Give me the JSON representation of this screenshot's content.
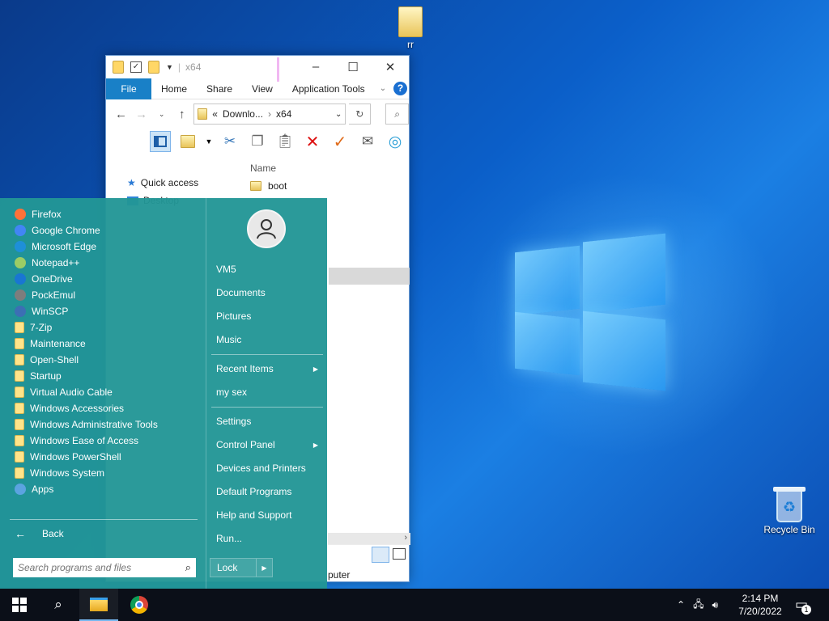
{
  "desktop": {
    "icons": [
      {
        "name": "folder-icon",
        "label": "rr"
      },
      {
        "name": "recycle-bin-icon",
        "label": "Recycle Bin"
      }
    ]
  },
  "explorer": {
    "title": "x64",
    "tabs": [
      {
        "label": "File"
      },
      {
        "label": "Home"
      },
      {
        "label": "Share"
      },
      {
        "label": "View"
      },
      {
        "label": "Application Tools"
      }
    ],
    "help": "?",
    "address": {
      "prefix": "«",
      "crumb1": "Downlo...",
      "crumb2": "x64"
    },
    "nav_items": [
      "Quick access",
      "Desktop"
    ],
    "column_header": "Name",
    "files": [
      "boot"
    ],
    "status_text": "puter"
  },
  "start_menu": {
    "programs": [
      {
        "label": "Firefox",
        "icon": "firefox-icon",
        "color": "#ff7139"
      },
      {
        "label": "Google Chrome",
        "icon": "chrome-icon",
        "color": "#4285f4"
      },
      {
        "label": "Microsoft Edge",
        "icon": "edge-icon",
        "color": "#1e8fd8"
      },
      {
        "label": "Notepad++",
        "icon": "notepadpp-icon",
        "color": "#9ccc65"
      },
      {
        "label": "OneDrive",
        "icon": "onedrive-icon",
        "color": "#1976d2"
      },
      {
        "label": "PockEmul",
        "icon": "pockemul-icon",
        "color": "#7d7d7d"
      },
      {
        "label": "WinSCP",
        "icon": "winscp-icon",
        "color": "#3c6fb4"
      },
      {
        "label": "7-Zip",
        "icon": "folder-icon",
        "color": "#ffe48a"
      },
      {
        "label": "Maintenance",
        "icon": "folder-icon",
        "color": "#ffe48a"
      },
      {
        "label": "Open-Shell",
        "icon": "folder-icon",
        "color": "#ffe48a"
      },
      {
        "label": "Startup",
        "icon": "folder-icon",
        "color": "#ffe48a"
      },
      {
        "label": "Virtual Audio Cable",
        "icon": "folder-icon",
        "color": "#ffe48a"
      },
      {
        "label": "Windows Accessories",
        "icon": "folder-icon",
        "color": "#ffe48a"
      },
      {
        "label": "Windows Administrative Tools",
        "icon": "folder-icon",
        "color": "#ffe48a"
      },
      {
        "label": "Windows Ease of Access",
        "icon": "folder-icon",
        "color": "#ffe48a"
      },
      {
        "label": "Windows PowerShell",
        "icon": "folder-icon",
        "color": "#ffe48a"
      },
      {
        "label": "Windows System",
        "icon": "folder-icon",
        "color": "#ffe48a"
      },
      {
        "label": "Apps",
        "icon": "apps-icon",
        "color": "#5ba3e0"
      }
    ],
    "back_label": "Back",
    "search_placeholder": "Search programs and files",
    "right_items": [
      {
        "label": "VM5",
        "submenu": false
      },
      {
        "label": "Documents",
        "submenu": false
      },
      {
        "label": "Pictures",
        "submenu": false
      },
      {
        "label": "Music",
        "submenu": false
      },
      {
        "label": "Recent Items",
        "submenu": true
      },
      {
        "label": "my sex",
        "submenu": false
      },
      {
        "label": "Settings",
        "submenu": false
      },
      {
        "label": "Control Panel",
        "submenu": true
      },
      {
        "label": "Devices and Printers",
        "submenu": false
      },
      {
        "label": "Default Programs",
        "submenu": false
      },
      {
        "label": "Help and Support",
        "submenu": false
      },
      {
        "label": "Run...",
        "submenu": false
      }
    ],
    "lock_label": "Lock"
  },
  "taskbar": {
    "time": "2:14 PM",
    "date": "7/20/2022",
    "notification_count": "1"
  },
  "colors": {
    "start_menu_bg": "#2296a0",
    "ribbon_file_tab": "#1980c7",
    "taskbar_bg": "#0b0f18"
  }
}
